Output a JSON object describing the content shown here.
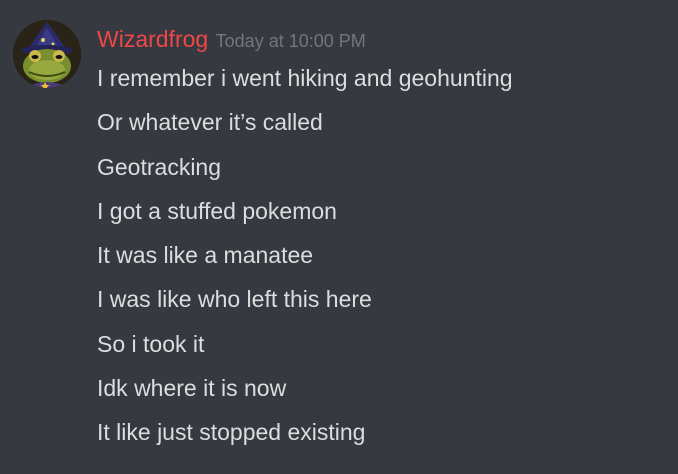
{
  "message": {
    "author": {
      "name": "Wizardfrog",
      "name_color": "#f04747",
      "avatar_icon": "wizard-frog-avatar-icon"
    },
    "timestamp": "Today at 10:00 PM",
    "lines": [
      "I remember i went hiking and geohunting",
      "Or whatever it’s called",
      "Geotracking",
      "I got a stuffed pokemon",
      "It was like a manatee",
      "I was like who left this here",
      "So i took it",
      "Idk where it is now",
      "It like just stopped existing"
    ]
  },
  "colors": {
    "background": "#36393f",
    "text": "#dcddde",
    "timestamp": "#72767d"
  }
}
